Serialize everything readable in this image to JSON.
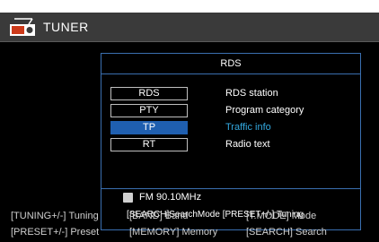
{
  "header": {
    "title": "TUNER",
    "icon": "radio-icon"
  },
  "panel": {
    "title": "RDS",
    "options": [
      {
        "label": "RDS",
        "description": "RDS station",
        "selected": false
      },
      {
        "label": "PTY",
        "description": "Program category",
        "selected": false
      },
      {
        "label": "TP",
        "description": "Traffic info",
        "selected": true
      },
      {
        "label": "RT",
        "description": "Radio text",
        "selected": false
      }
    ],
    "band": "FM",
    "frequency": "90.10MHz",
    "hint": {
      "search_key": "[SEARCH]",
      "search_label": "SearchMode",
      "preset_key": "[PRESET+/-]",
      "preset_label": "Tuning"
    }
  },
  "bottom_bar": {
    "row1": [
      {
        "key": "[TUNING+/-]",
        "label": "Tuning"
      },
      {
        "key": "[BAND]",
        "label": "Band"
      },
      {
        "key": "[T.MODE]",
        "label": "Mode"
      }
    ],
    "row2": [
      {
        "key": "[PRESET+/-]",
        "label": "Preset"
      },
      {
        "key": "[MEMORY]",
        "label": "Memory"
      },
      {
        "key": "[SEARCH]",
        "label": "Search"
      }
    ]
  },
  "colors": {
    "background": "#000000",
    "header": "#3a3a3a",
    "panel_border": "#3a6fb0",
    "selected": "#1f5fb0",
    "highlight_text": "#33a9e0",
    "icon_red": "#cc3a1a"
  }
}
